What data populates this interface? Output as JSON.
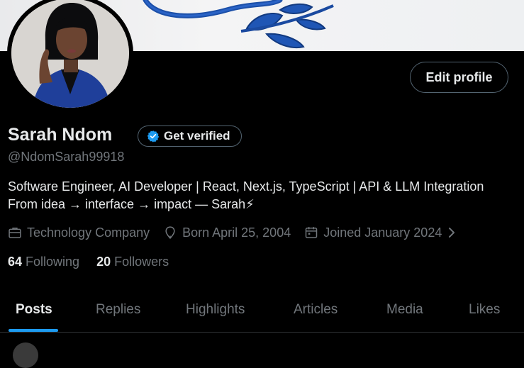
{
  "profile": {
    "display_name": "Sarah Ndom",
    "handle": "@NdomSarah99918",
    "bio_line1": "Software Engineer, AI Developer | React, Next.js, TypeScript | API & LLM Integration",
    "bio_line2": "From idea → interface → impact — Sarah⚡",
    "category": "Technology Company",
    "birthday": "Born April 25, 2004",
    "joined": "Joined January 2024"
  },
  "buttons": {
    "edit_profile": "Edit profile",
    "get_verified": "Get verified"
  },
  "stats": {
    "following_count": "64",
    "following_label": "Following",
    "followers_count": "20",
    "followers_label": "Followers"
  },
  "tabs": [
    {
      "label": "Posts",
      "active": true
    },
    {
      "label": "Replies"
    },
    {
      "label": "Highlights"
    },
    {
      "label": "Articles"
    },
    {
      "label": "Media"
    },
    {
      "label": "Likes"
    }
  ],
  "colors": {
    "background": "#000000",
    "accent": "#1d9bf0",
    "text_primary": "#e7e9ea",
    "text_secondary": "#71767b",
    "border": "#536471"
  },
  "icons": [
    "verified-badge-icon",
    "briefcase-icon",
    "location-pin-icon",
    "calendar-icon",
    "chevron-right-icon"
  ]
}
